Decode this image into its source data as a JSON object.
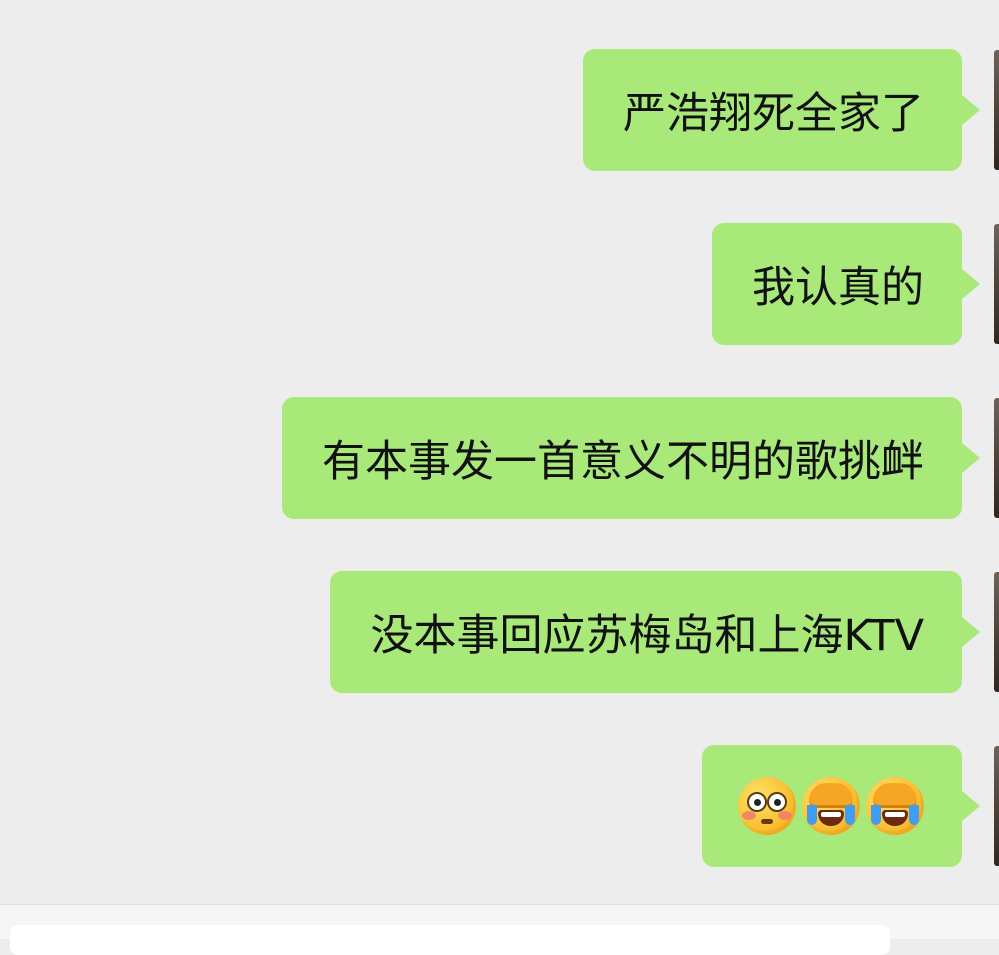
{
  "messages": [
    {
      "text": "严浩翔死全家了"
    },
    {
      "text": "我认真的"
    },
    {
      "text": "有本事发一首意义不明的歌挑衅"
    },
    {
      "text": "没本事回应苏梅岛和上海KTV"
    },
    {
      "emojis": [
        "flushed-face",
        "face-palm-crying",
        "face-palm-crying"
      ]
    }
  ],
  "colors": {
    "chat_background": "#ededed",
    "outgoing_bubble": "#a9e97a",
    "text": "#111111",
    "input_bar": "#f6f6f6"
  }
}
